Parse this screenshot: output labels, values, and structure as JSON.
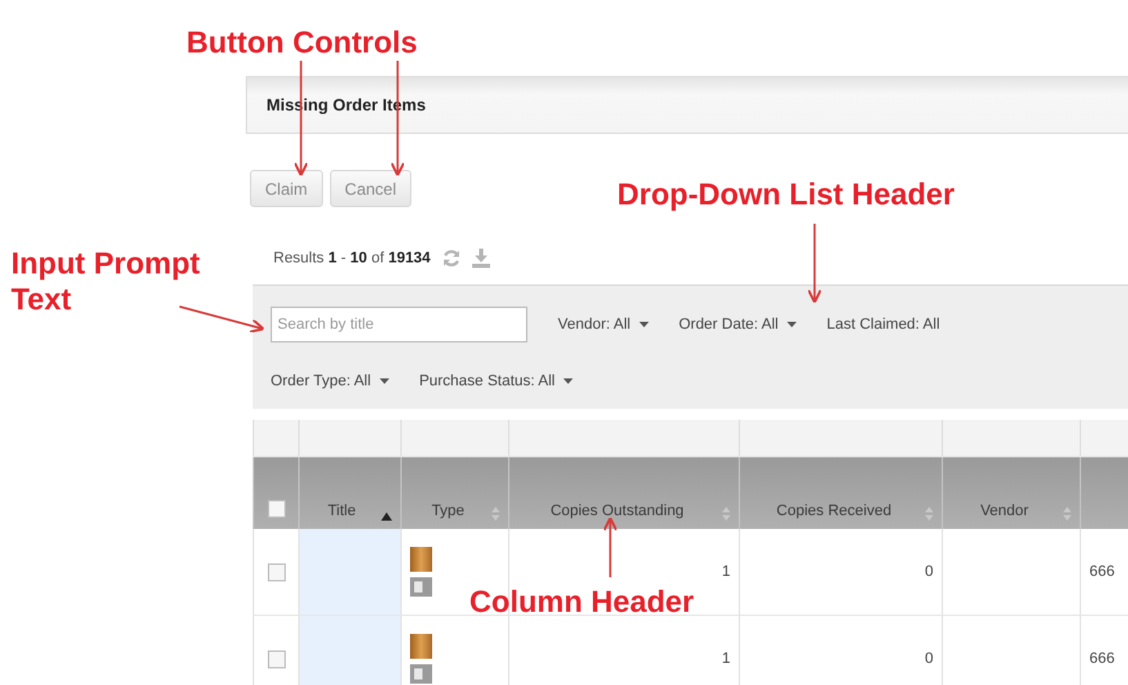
{
  "annotations": [
    {
      "kind": "buttons",
      "text": "Button Controls"
    },
    {
      "kind": "prompt",
      "text": "Input Prompt Text"
    },
    {
      "kind": "dropdown",
      "text": "Drop-Down List  Header"
    },
    {
      "kind": "column",
      "text": "Column Header"
    }
  ],
  "panel": {
    "title": "Missing Order Items"
  },
  "buttons": [
    {
      "label": "Claim",
      "disabled": true
    },
    {
      "label": "Cancel",
      "disabled": true
    }
  ],
  "results": "Results **1** - **10** of **19134**",
  "search": {
    "placeholder": "Search by title"
  },
  "filter_rows": [
    [
      {
        "label": "Vendor: All",
        "caret": true
      },
      {
        "label": "Order Date: All",
        "caret": true
      },
      {
        "label": "Last Claimed: All",
        "caret": false
      }
    ],
    [
      {
        "label": "Order Type: All",
        "caret": true
      },
      {
        "label": "Purchase Status: All",
        "caret": true
      }
    ]
  ],
  "table": {
    "select_all_checked": false,
    "columns": [
      {
        "label": "Title",
        "sorted_ascending": true
      },
      {
        "label": "Type",
        "sorted_ascending": false
      },
      {
        "label": "Copies Outstanding",
        "sorted_ascending": false
      },
      {
        "label": "Copies Received",
        "sorted_ascending": false
      },
      {
        "label": "Vendor",
        "sorted_ascending": false
      }
    ],
    "rows": [
      {
        "checked": false,
        "copies_outstanding": "1",
        "copies_received": "0",
        "column_7": "666"
      },
      {
        "checked": false,
        "copies_outstanding": "1",
        "copies_received": "0",
        "column_7": "666"
      }
    ]
  }
}
